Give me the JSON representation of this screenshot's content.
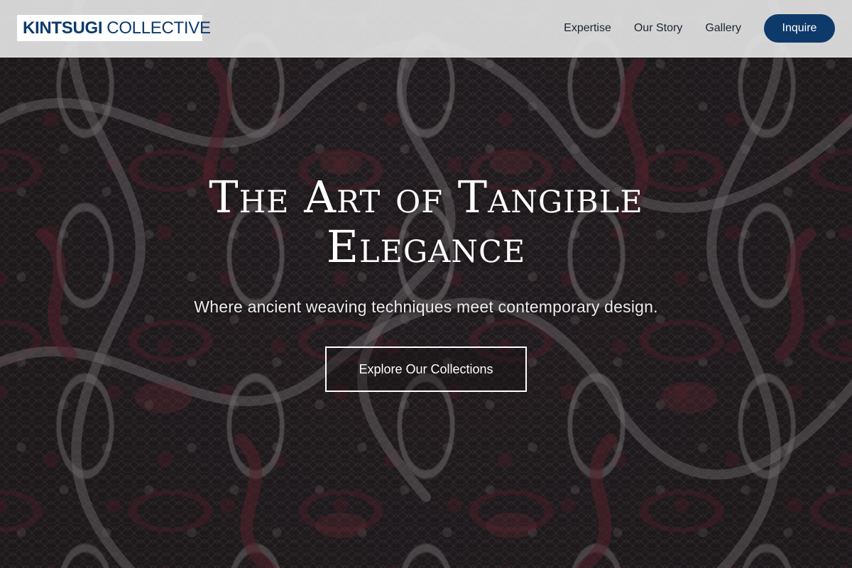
{
  "header": {
    "logo": {
      "bold_text": "KINTSUGI",
      "light_text": "COLLECTIVE"
    },
    "nav": {
      "items": [
        {
          "label": "Expertise"
        },
        {
          "label": "Our Story"
        },
        {
          "label": "Gallery"
        }
      ],
      "cta_label": "Inquire"
    }
  },
  "hero": {
    "title": "The Art of Tangible Elegance",
    "subtitle": "Where ancient weaving techniques meet contemporary design.",
    "cta_label": "Explore Our Collections",
    "background": "woven-carpet-image"
  },
  "colors": {
    "brand_navy": "#0d3a6b",
    "header_bg": "#e2e2e2",
    "hero_text": "#ffffff"
  }
}
